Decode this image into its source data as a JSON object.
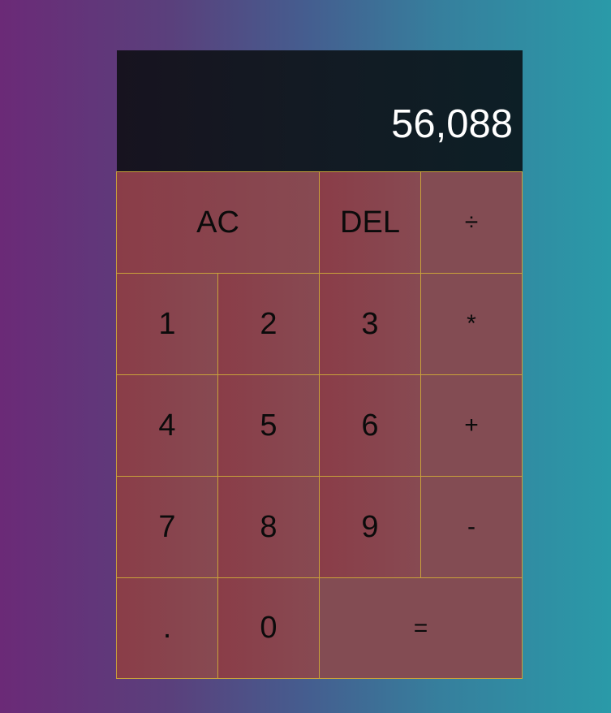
{
  "display": {
    "value": "56,088"
  },
  "keys": {
    "all_clear": "AC",
    "delete": "DEL",
    "divide": "÷",
    "one": "1",
    "two": "2",
    "three": "3",
    "multiply": "*",
    "four": "4",
    "five": "5",
    "six": "6",
    "add": "+",
    "seven": "7",
    "eight": "8",
    "nine": "9",
    "subtract": "-",
    "decimal": ".",
    "zero": "0",
    "equals": "="
  },
  "colors": {
    "background_left": "#6b2a77",
    "background_right": "#2a9aa8",
    "display_background": "#131a23",
    "key_background": "#8a3d48",
    "key_border": "#c9a23a",
    "display_text": "#ffffff",
    "key_text": "#0b0b0b"
  }
}
